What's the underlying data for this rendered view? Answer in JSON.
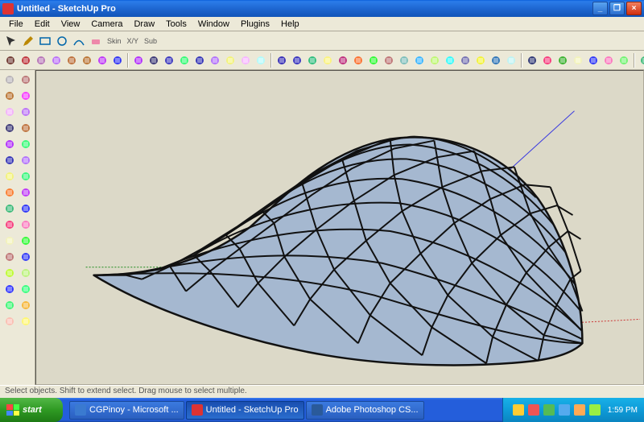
{
  "window": {
    "title": "Untitled - SketchUp Pro",
    "min": "_",
    "max": "❐",
    "close": "×"
  },
  "menu": [
    "File",
    "Edit",
    "View",
    "Camera",
    "Draw",
    "Tools",
    "Window",
    "Plugins",
    "Help"
  ],
  "row1_labels": {
    "skin": "Skin",
    "xy": "X/Y",
    "sub": "Sub"
  },
  "statusbar": "Select objects. Shift to extend select. Drag mouse to select multiple.",
  "taskbar": {
    "start": "start",
    "tasks": [
      {
        "label": "CGPinoy - Microsoft ...",
        "active": false
      },
      {
        "label": "Untitled - SketchUp Pro",
        "active": true
      },
      {
        "label": "Adobe Photoshop CS...",
        "active": false
      }
    ],
    "clock": "1:59 PM"
  },
  "colors": {
    "axis_x": "#c33",
    "axis_y": "#1a8a1a",
    "axis_z": "#3a3ae0",
    "viewport_bg": "#dcd9c8",
    "mesh_fill": "#a5b8d0",
    "mesh_stroke": "#111"
  },
  "top_tools": [
    "select-arrow",
    "pencil",
    "rectangle",
    "circle",
    "arc",
    "eraser",
    "tape",
    "paint-bucket",
    "sep",
    "freehand",
    "polygon",
    "extrude",
    "move",
    "rotate",
    "scale",
    "offset",
    "rewind",
    "search",
    "sep",
    "iso",
    "top",
    "front",
    "right",
    "back",
    "perspective",
    "orbit",
    "pan",
    "field-of-view",
    "styles",
    "hidden",
    "layers",
    "display-settings",
    "shadow",
    "xray",
    "wireframe",
    "sep",
    "component",
    "section",
    "ruby",
    "dims",
    "text",
    "axes",
    "3dtext",
    "sep",
    "protractor",
    "sep",
    "push",
    "follow",
    "sandbox",
    "drape",
    "stamp",
    "library",
    "warehouse",
    "plugin",
    "help"
  ],
  "left_tools": [
    "select",
    "line",
    "eraser",
    "paint",
    "rect",
    "circle",
    "polygon",
    "arc",
    "freehand",
    "move",
    "rotate",
    "scale",
    "offset",
    "pushpull",
    "followme",
    "tape",
    "protractor",
    "text",
    "section",
    "axes",
    "dims",
    "orbit",
    "pan",
    "zoom",
    "zoom-window",
    "zoom-extents",
    "prev",
    "next",
    "position",
    "walk",
    "lookaround",
    "shadows"
  ]
}
